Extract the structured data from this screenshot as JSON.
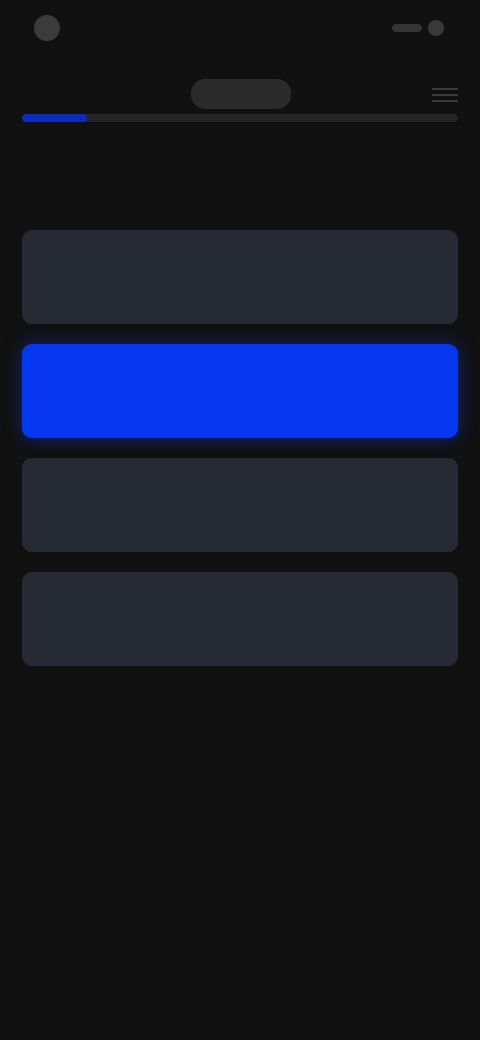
{
  "status": {
    "carrier_text": ""
  },
  "progress": {
    "value": 0.15
  },
  "question": {
    "text": ""
  },
  "options": [
    {
      "label": "",
      "selected": false
    },
    {
      "label": "",
      "selected": true
    },
    {
      "label": "",
      "selected": false
    },
    {
      "label": "",
      "selected": false
    }
  ],
  "colors": {
    "background": "#111111",
    "option": "#262a33",
    "selected": "#0637f0",
    "progress": "#0a2bbd"
  }
}
